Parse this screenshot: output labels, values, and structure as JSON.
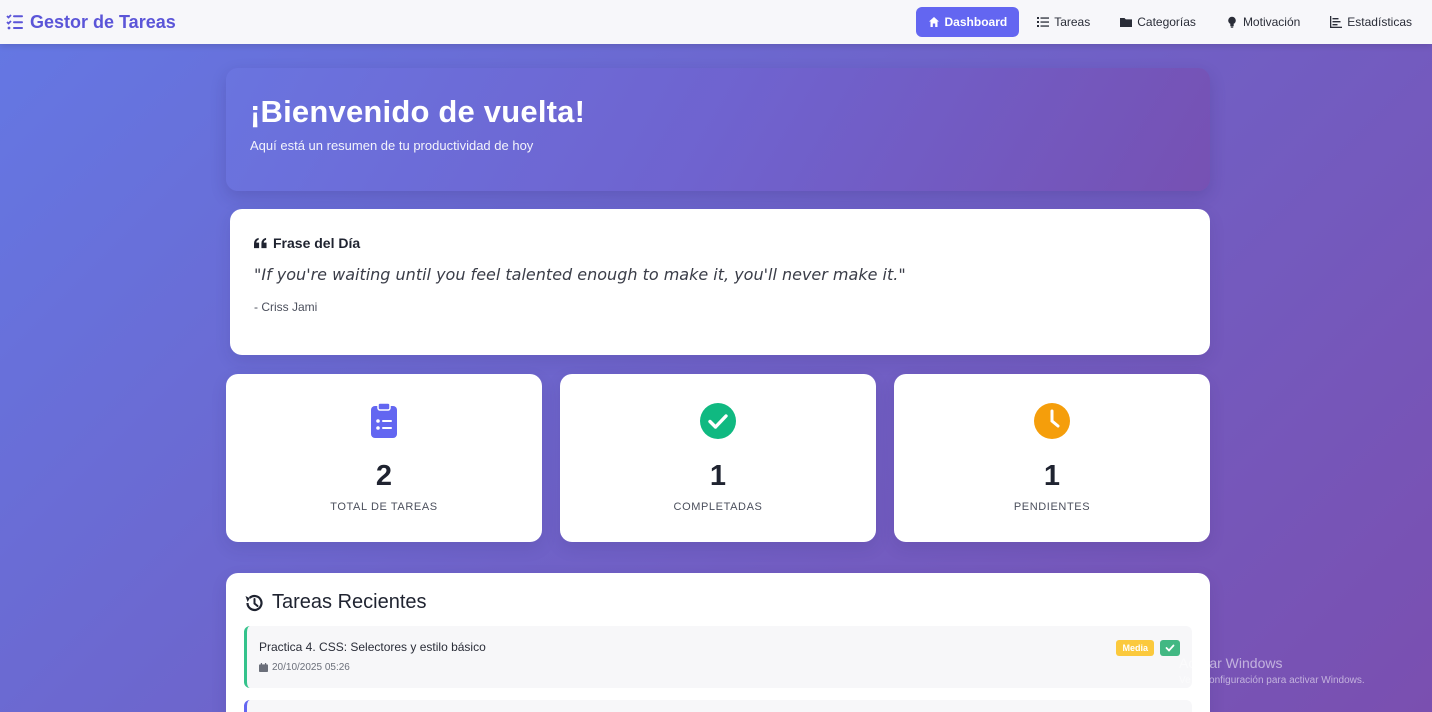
{
  "brand": {
    "name": "Gestor de Tareas"
  },
  "nav": [
    {
      "label": "Dashboard",
      "icon": "home-icon",
      "active": true
    },
    {
      "label": "Tareas",
      "icon": "list-icon",
      "active": false
    },
    {
      "label": "Categorías",
      "icon": "folder-icon",
      "active": false
    },
    {
      "label": "Motivación",
      "icon": "lightbulb-icon",
      "active": false
    },
    {
      "label": "Estadísticas",
      "icon": "chart-icon",
      "active": false
    }
  ],
  "hero": {
    "title": "¡Bienvenido de vuelta!",
    "subtitle": "Aquí está un resumen de tu productividad de hoy"
  },
  "quote": {
    "title": "Frase del Día",
    "text": "\"If you're waiting until you feel talented enough to make it, you'll never make it.\"",
    "author": "- Criss Jami"
  },
  "stats": [
    {
      "value": "2",
      "label": "TOTAL DE TAREAS",
      "icon": "clipboard-list-icon",
      "color": "#6366f1"
    },
    {
      "value": "1",
      "label": "COMPLETADAS",
      "icon": "check-circle-icon",
      "color": "#10b981"
    },
    {
      "value": "1",
      "label": "PENDIENTES",
      "icon": "clock-icon",
      "color": "#f59e0b"
    }
  ],
  "recent": {
    "title": "Tareas Recientes",
    "tasks": [
      {
        "title": "Practica 4. CSS: Selectores y estilo básico",
        "date": "20/10/2025 05:26",
        "priority": "Media",
        "completed": true
      }
    ]
  },
  "watermark": {
    "line1": "Activar Windows",
    "line2": "Ve a Configuración para activar Windows."
  },
  "colors": {
    "accent": "#6366f1",
    "success": "#10b981",
    "warning": "#f59e0b",
    "priority_media": "#fbc93d"
  }
}
